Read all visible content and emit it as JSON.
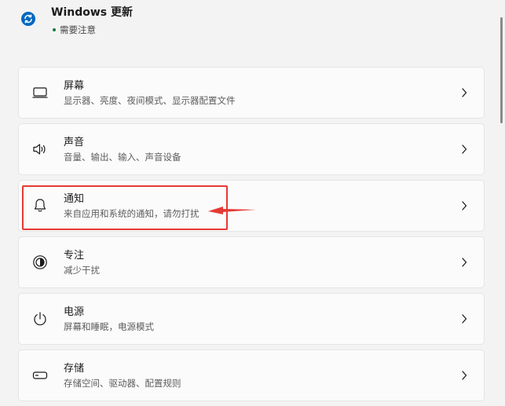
{
  "windows_update": {
    "title": "Windows 更新",
    "status": "需要注意",
    "icon": "sync-icon",
    "accent_color": "#0067c0",
    "status_color": "#107c41"
  },
  "settings_items": [
    {
      "title": "屏幕",
      "description": "显示器、亮度、夜间模式、显示器配置文件",
      "icon": "monitor-icon"
    },
    {
      "title": "声音",
      "description": "音量、输出、输入、声音设备",
      "icon": "speaker-icon"
    },
    {
      "title": "通知",
      "description": "来自应用和系统的通知，请勿打扰",
      "icon": "bell-icon"
    },
    {
      "title": "专注",
      "description": "减少干扰",
      "icon": "focus-icon"
    },
    {
      "title": "电源",
      "description": "屏幕和睡眠，电源模式",
      "icon": "power-icon"
    },
    {
      "title": "存储",
      "description": "存储空间、驱动器、配置规则",
      "icon": "storage-icon"
    }
  ],
  "annotation": {
    "highlight_color": "#e53935",
    "target": "通知"
  }
}
